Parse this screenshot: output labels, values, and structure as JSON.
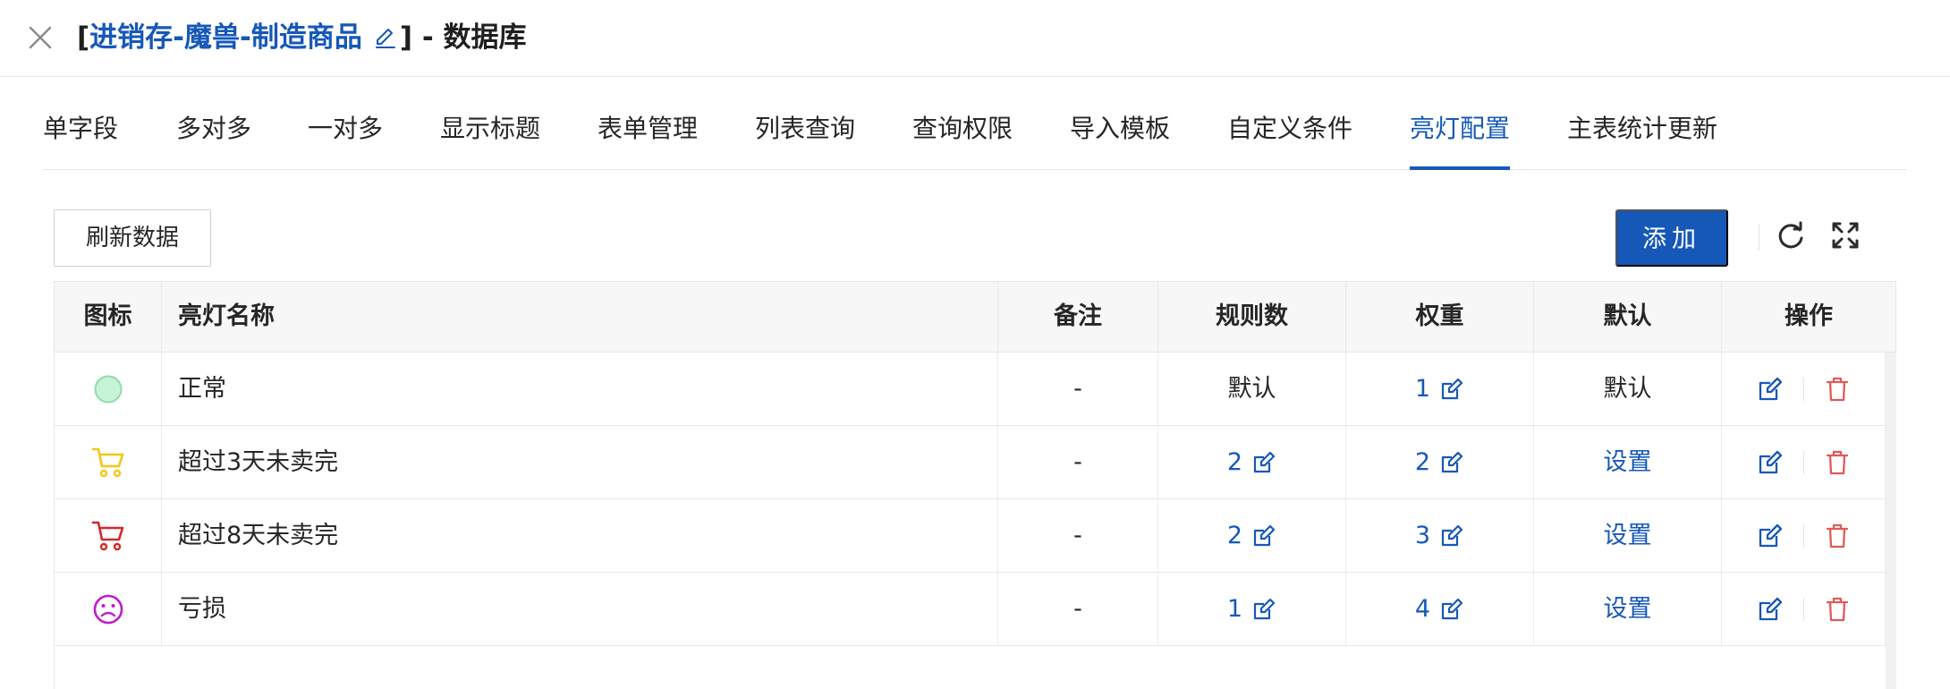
{
  "header": {
    "bracket_open": "[",
    "title_link": "进销存-魔兽-制造商品",
    "bracket_close": "]",
    "title_suffix": " - 数据库",
    "close_icon": "close-icon",
    "edit_icon": "pencil-icon"
  },
  "tabs": [
    {
      "label": "单字段"
    },
    {
      "label": "多对多"
    },
    {
      "label": "一对多"
    },
    {
      "label": "显示标题"
    },
    {
      "label": "表单管理"
    },
    {
      "label": "列表查询"
    },
    {
      "label": "查询权限"
    },
    {
      "label": "导入模板"
    },
    {
      "label": "自定义条件"
    },
    {
      "label": "亮灯配置",
      "active": true
    },
    {
      "label": "主表统计更新"
    }
  ],
  "toolbar": {
    "refresh_label": "刷新数据",
    "add_label": "添加",
    "reload_icon": "reload-icon",
    "fullscreen_icon": "fullscreen-icon"
  },
  "table": {
    "columns": [
      "图标",
      "亮灯名称",
      "备注",
      "规则数",
      "权重",
      "默认",
      "操作"
    ],
    "rows": [
      {
        "icon": "circle-icon",
        "icon_color": "#bff0cf",
        "name": "正常",
        "remark": "-",
        "rules": "默认",
        "rules_editable": false,
        "weight": "1",
        "default": "默认",
        "default_is_link": false
      },
      {
        "icon": "cart-icon",
        "icon_color": "#f5c518",
        "name": "超过3天未卖完",
        "remark": "-",
        "rules": "2",
        "rules_editable": true,
        "weight": "2",
        "default": "设置",
        "default_is_link": true
      },
      {
        "icon": "cart-icon",
        "icon_color": "#d4282b",
        "name": "超过8天未卖完",
        "remark": "-",
        "rules": "2",
        "rules_editable": true,
        "weight": "3",
        "default": "设置",
        "default_is_link": true
      },
      {
        "icon": "sad-face-icon",
        "icon_color": "#c21bc9",
        "name": "亏损",
        "remark": "-",
        "rules": "1",
        "rules_editable": true,
        "weight": "4",
        "default": "设置",
        "default_is_link": true
      }
    ]
  },
  "colors": {
    "primary": "#1658b8",
    "delete": "#e05a5a"
  }
}
